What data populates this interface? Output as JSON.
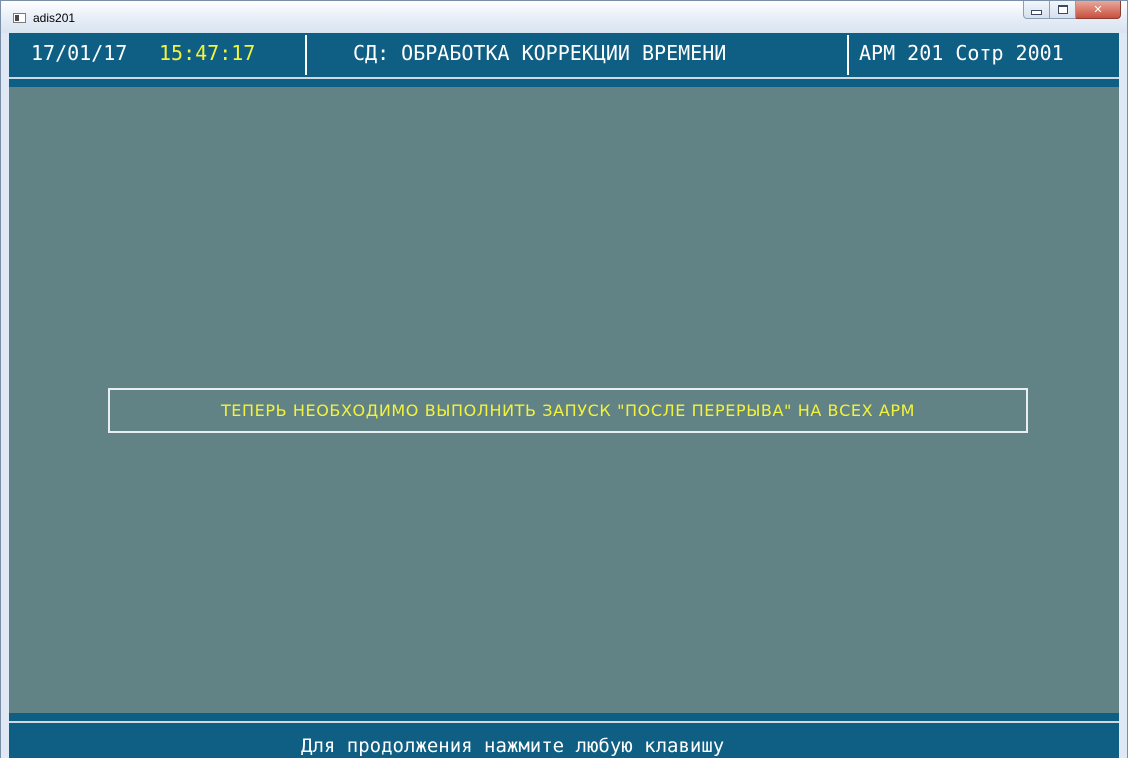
{
  "window": {
    "title": "adis201",
    "controls": {
      "minimize": "minimize",
      "maximize": "maximize",
      "close": "✕"
    }
  },
  "header": {
    "date": "17/01/17",
    "time": "15:47:17",
    "title": "СД: ОБРАБОТКА КОРРЕКЦИИ ВРЕМЕНИ",
    "workstation": "АРМ 201 Сотр 2001"
  },
  "message": {
    "text": "ТЕПЕРЬ НЕОБХОДИМО ВЫПОЛНИТЬ ЗАПУСК \"ПОСЛЕ ПЕРЕРЫВА\" НА ВСЕХ АРМ"
  },
  "footer": {
    "prompt": "Для продолжения нажмите любую клавишу"
  },
  "colors": {
    "background": "#628386",
    "bar": "#0e5f83",
    "highlight": "#f3f33c",
    "text": "#ffffff"
  }
}
